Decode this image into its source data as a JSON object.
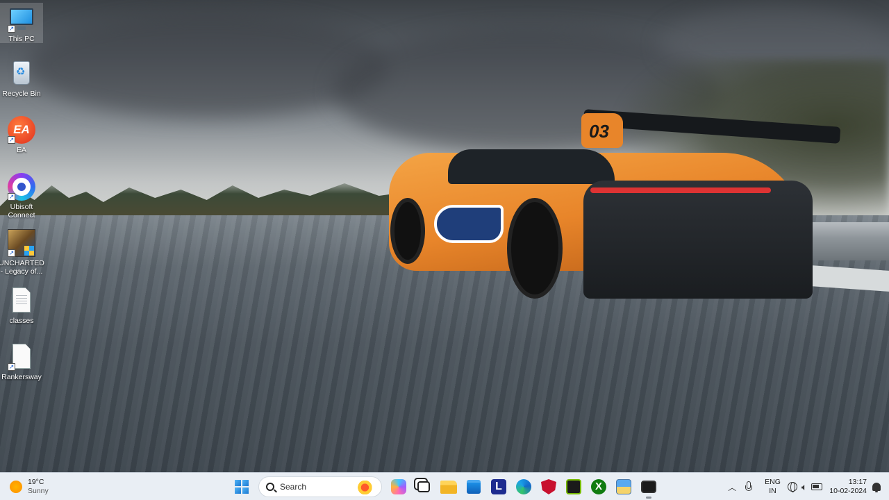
{
  "desktop": {
    "icons": [
      {
        "label": "This PC",
        "icon": "this-pc-icon",
        "shortcut": true
      },
      {
        "label": "Recycle Bin",
        "icon": "recycle-bin-icon",
        "shortcut": false
      },
      {
        "label": "EA",
        "icon": "ea-app-icon",
        "shortcut": true
      },
      {
        "label": "Ubisoft Connect",
        "icon": "ubisoft-connect-icon",
        "shortcut": true
      },
      {
        "label": "UNCHARTED - Legacy of...",
        "icon": "uncharted-game-icon",
        "shortcut": true
      },
      {
        "label": "classes",
        "icon": "text-file-icon",
        "shortcut": false
      },
      {
        "label": "Rankersway",
        "icon": "file-shortcut-icon",
        "shortcut": true
      }
    ],
    "wallpaper": {
      "car_number": "03"
    }
  },
  "taskbar": {
    "weather": {
      "temp": "19°C",
      "condition": "Sunny",
      "icon": "sun-icon"
    },
    "search": {
      "placeholder": "Search"
    },
    "apps": [
      {
        "name": "start",
        "icon": "windows-logo-icon"
      },
      {
        "name": "copilot",
        "icon": "copilot-icon"
      },
      {
        "name": "task-view",
        "icon": "task-view-icon"
      },
      {
        "name": "file-explorer",
        "icon": "folder-icon"
      },
      {
        "name": "microsoft-store",
        "icon": "store-icon"
      },
      {
        "name": "lenovo",
        "icon": "lenovo-l-icon",
        "glyph": "L"
      },
      {
        "name": "edge",
        "icon": "edge-icon"
      },
      {
        "name": "mcafee",
        "icon": "mcafee-icon"
      },
      {
        "name": "nvidia",
        "icon": "nvidia-icon"
      },
      {
        "name": "xbox",
        "icon": "xbox-icon",
        "glyph": "X"
      },
      {
        "name": "paint",
        "icon": "paint-icon"
      },
      {
        "name": "app-monitor",
        "icon": "monitor-app-icon"
      }
    ],
    "tray": {
      "language_top": "ENG",
      "language_bottom": "IN",
      "time": "13:17",
      "date": "10-02-2024"
    }
  }
}
